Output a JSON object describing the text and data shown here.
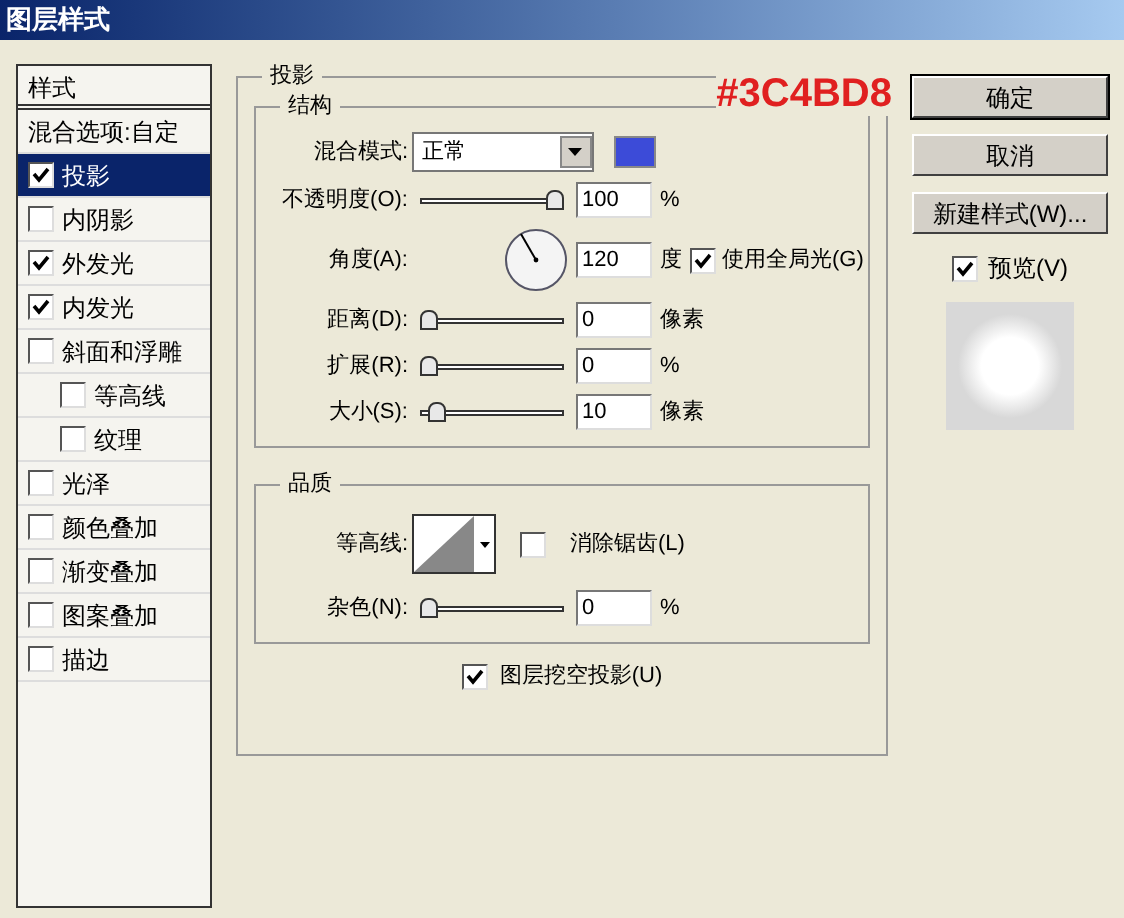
{
  "window": {
    "title": "图层样式"
  },
  "sidebar": {
    "header": "样式",
    "items": [
      {
        "label": "混合选项:自定",
        "kind": "plain",
        "selected": false
      },
      {
        "label": "投影",
        "kind": "check",
        "checked": true,
        "selected": true
      },
      {
        "label": "内阴影",
        "kind": "check",
        "checked": false,
        "selected": false
      },
      {
        "label": "外发光",
        "kind": "check",
        "checked": true,
        "selected": false
      },
      {
        "label": "内发光",
        "kind": "check",
        "checked": true,
        "selected": false
      },
      {
        "label": "斜面和浮雕",
        "kind": "check",
        "checked": false,
        "selected": false,
        "children": [
          {
            "label": "等高线",
            "kind": "check",
            "checked": false,
            "selected": false
          },
          {
            "label": "纹理",
            "kind": "check",
            "checked": false,
            "selected": false
          }
        ]
      },
      {
        "label": "光泽",
        "kind": "check",
        "checked": false,
        "selected": false
      },
      {
        "label": "颜色叠加",
        "kind": "check",
        "checked": false,
        "selected": false
      },
      {
        "label": "渐变叠加",
        "kind": "check",
        "checked": false,
        "selected": false
      },
      {
        "label": "图案叠加",
        "kind": "check",
        "checked": false,
        "selected": false
      },
      {
        "label": "描边",
        "kind": "check",
        "checked": false,
        "selected": false
      }
    ]
  },
  "panel": {
    "title": "投影",
    "annotation": "#3C4BD8",
    "structure": {
      "title": "结构",
      "blend_mode": {
        "label": "混合模式:",
        "value": "正常",
        "color": "#3c4bd8"
      },
      "opacity": {
        "label": "不透明度(O):",
        "level": 1,
        "value": "100",
        "unit": "%"
      },
      "angle": {
        "label": "角度(A):",
        "value": "120",
        "unit": "度",
        "global_light": {
          "label": "使用全局光(G)",
          "checked": true
        }
      },
      "sliders": [
        {
          "label": "距离(D):",
          "level": 0,
          "value": "0",
          "unit": "像素"
        },
        {
          "label": "扩展(R):",
          "level": 0,
          "value": "0",
          "unit": "%"
        },
        {
          "label": "大小(S):",
          "level": 0.07,
          "value": "10",
          "unit": "像素"
        }
      ]
    },
    "quality": {
      "title": "品质",
      "contour_label": "等高线:",
      "anti_alias": {
        "label": "消除锯齿(L)",
        "checked": false
      },
      "noise": {
        "label": "杂色(N):",
        "level": 0,
        "value": "0",
        "unit": "%"
      }
    },
    "knockout": {
      "label": "图层挖空投影(U)",
      "checked": true
    }
  },
  "buttons": [
    {
      "label": "确定",
      "default": true
    },
    {
      "label": "取消",
      "default": false
    },
    {
      "label": "新建样式(W)..."
    }
  ],
  "preview": {
    "label": "预览(V)",
    "checked": true
  }
}
